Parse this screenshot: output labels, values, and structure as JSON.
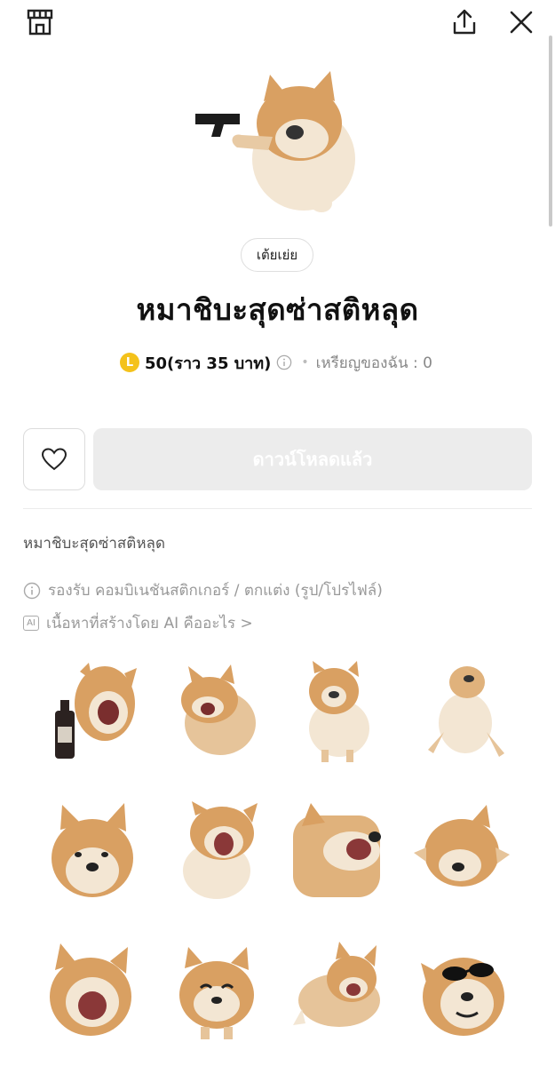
{
  "header": {
    "shop_icon": "shop-icon",
    "share_icon": "share-icon",
    "close_icon": "close-icon"
  },
  "product": {
    "author": "เต้ยเย่ย",
    "title": "หมาชิบะสุดซ่าสติหลุด",
    "coin_symbol": "L",
    "price": "50(ราว 35 บาท)",
    "my_coins": "เหรียญของฉัน : 0",
    "download_label": "ดาวน์โหลดแล้ว",
    "description": "หมาชิบะสุดซ่าสติหลุด",
    "support_text": "รองรับ คอมบิเนชันสติกเกอร์ / ตกแต่ง (รูป/โปรไฟล์)",
    "ai_badge": "AI",
    "ai_text": "เนื้อหาที่สร้างโดย AI คืออะไร >"
  },
  "colors": {
    "coin": "#f4c21b",
    "button_disabled": "#ececec",
    "shiba_orange": "#d9a062",
    "shiba_cream": "#f3e6d3"
  },
  "stickers": [
    {
      "name": "sticker-shiba-beer"
    },
    {
      "name": "sticker-shiba-laughing"
    },
    {
      "name": "sticker-shiba-howl"
    },
    {
      "name": "sticker-shiba-dancing"
    },
    {
      "name": "sticker-shiba-face"
    },
    {
      "name": "sticker-shiba-scream"
    },
    {
      "name": "sticker-shiba-blur-shout"
    },
    {
      "name": "sticker-shiba-spinning"
    },
    {
      "name": "sticker-shiba-yelling"
    },
    {
      "name": "sticker-shiba-smile"
    },
    {
      "name": "sticker-shiba-crawl"
    },
    {
      "name": "sticker-shiba-sunglasses"
    }
  ]
}
